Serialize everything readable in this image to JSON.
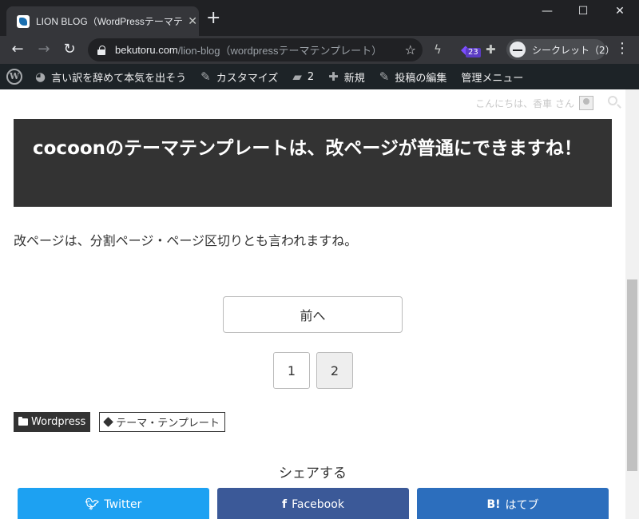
{
  "browser": {
    "tab_title": "LION BLOG（WordPressテーマテン",
    "tab_close": "✕",
    "new_tab": "+",
    "window_controls": {
      "minimize": "—",
      "maximize": "☐",
      "close": "✕"
    },
    "url_host": "bekutoru.com",
    "url_path": "/lion-blog（wordpressテーマテンプレート）...",
    "extension_badge": "23",
    "incognito_label": "シークレット（2）"
  },
  "admin_bar": {
    "site_name": "言い訳を辞めて本気を出そう",
    "customize": "カスタマイズ",
    "comments_count": "2",
    "new": "新規",
    "edit_post": "投稿の編集",
    "admin_menu": "管理メニュー"
  },
  "page": {
    "greeting": "こんにちは、香車 さん",
    "heading": "cocoonのテーマテンプレートは、改ページが普通にできますね！",
    "body_text": "改ページは、分割ページ・ページ区切りとも言われますね。",
    "prev_button": "前へ",
    "pages": [
      "1",
      "2"
    ],
    "current_page": "2",
    "category": "Wordpress",
    "tag": "テーマ・テンプレート",
    "share_title": "シェアする",
    "share_buttons": [
      {
        "label": "Twitter",
        "icon": "twitter-icon",
        "color": "#1da1f2"
      },
      {
        "label": "Facebook",
        "icon": "facebook-icon",
        "color": "#3b5998"
      },
      {
        "label": "はてブ",
        "icon": "hatena-icon",
        "color": "#2c6ebd"
      }
    ]
  },
  "colors": {
    "heading_bg": "#333333",
    "admin_bar_bg": "#1d2327",
    "browser_bg": "#202124"
  }
}
